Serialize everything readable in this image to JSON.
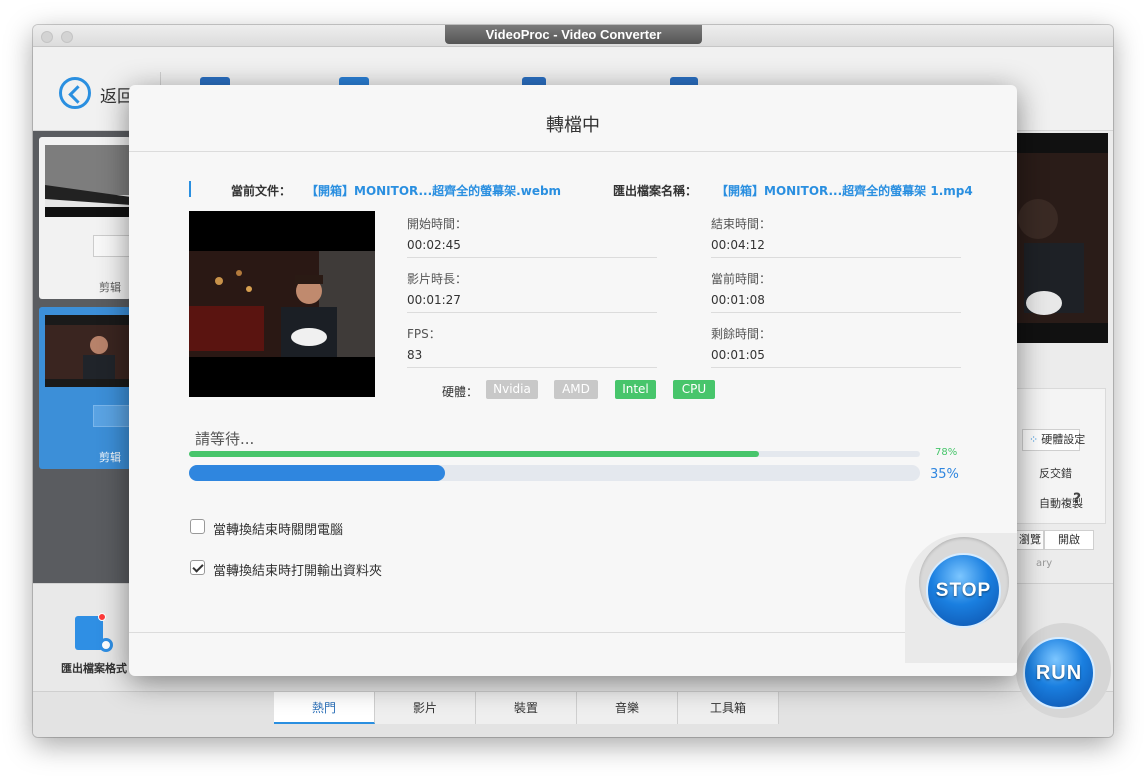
{
  "window": {
    "title": "VideoProc - Video Converter"
  },
  "toolbar": {
    "back_label": "返回"
  },
  "left_list": {
    "items": [
      {
        "label": "剪辑"
      },
      {
        "label": "剪辑"
      }
    ]
  },
  "bottom": {
    "format_label": "匯出檔案格式"
  },
  "tabs": [
    {
      "label": "熱門",
      "active": true
    },
    {
      "label": "影片"
    },
    {
      "label": "裝置"
    },
    {
      "label": "音樂"
    },
    {
      "label": "工具箱"
    }
  ],
  "right_panel": {
    "hw_settings": "硬體設定",
    "deinterlace": "反交錯",
    "auto_copy": "自動複製",
    "help": "?",
    "browse": "瀏覽",
    "open": "開啟",
    "library_suffix": "ary"
  },
  "run_label": "RUN",
  "dialog": {
    "title": "轉檔中",
    "current_file_label": "當前文件：",
    "current_file": "【開箱】MONITOR...超齊全的螢幕架.webm",
    "output_name_label": "匯出檔案名稱：",
    "output_name": "【開箱】MONITOR...超齊全的螢幕架 1.mp4",
    "stats": {
      "start_time": {
        "label": "開始時間：",
        "value": "00:02:45"
      },
      "end_time": {
        "label": "結束時間：",
        "value": "00:04:12"
      },
      "duration": {
        "label": "影片時長：",
        "value": "00:01:27"
      },
      "current_time": {
        "label": "當前時間：",
        "value": "00:01:08"
      },
      "fps": {
        "label": "FPS：",
        "value": "83"
      },
      "remaining": {
        "label": "剩餘時間：",
        "value": "00:01:05"
      }
    },
    "hardware": {
      "label": "硬體：",
      "tags": [
        {
          "name": "Nvidia",
          "active": false,
          "color": "#c8c8c8"
        },
        {
          "name": "AMD",
          "active": false,
          "color": "#c8c8c8"
        },
        {
          "name": "Intel",
          "active": true,
          "color": "#47c56b"
        },
        {
          "name": "CPU",
          "active": true,
          "color": "#47c56b"
        }
      ]
    },
    "status_text": "請等待...",
    "progress_total": {
      "fraction": 0.78,
      "label": "78%",
      "color": "#47c56b"
    },
    "progress_file": {
      "fraction": 0.35,
      "label": "35%",
      "color": "#2f86df"
    },
    "options": [
      {
        "label": "當轉換結束時關閉電腦",
        "checked": false
      },
      {
        "label": "當轉換結束時打開輸出資料夾",
        "checked": true
      }
    ],
    "stop_label": "STOP"
  }
}
